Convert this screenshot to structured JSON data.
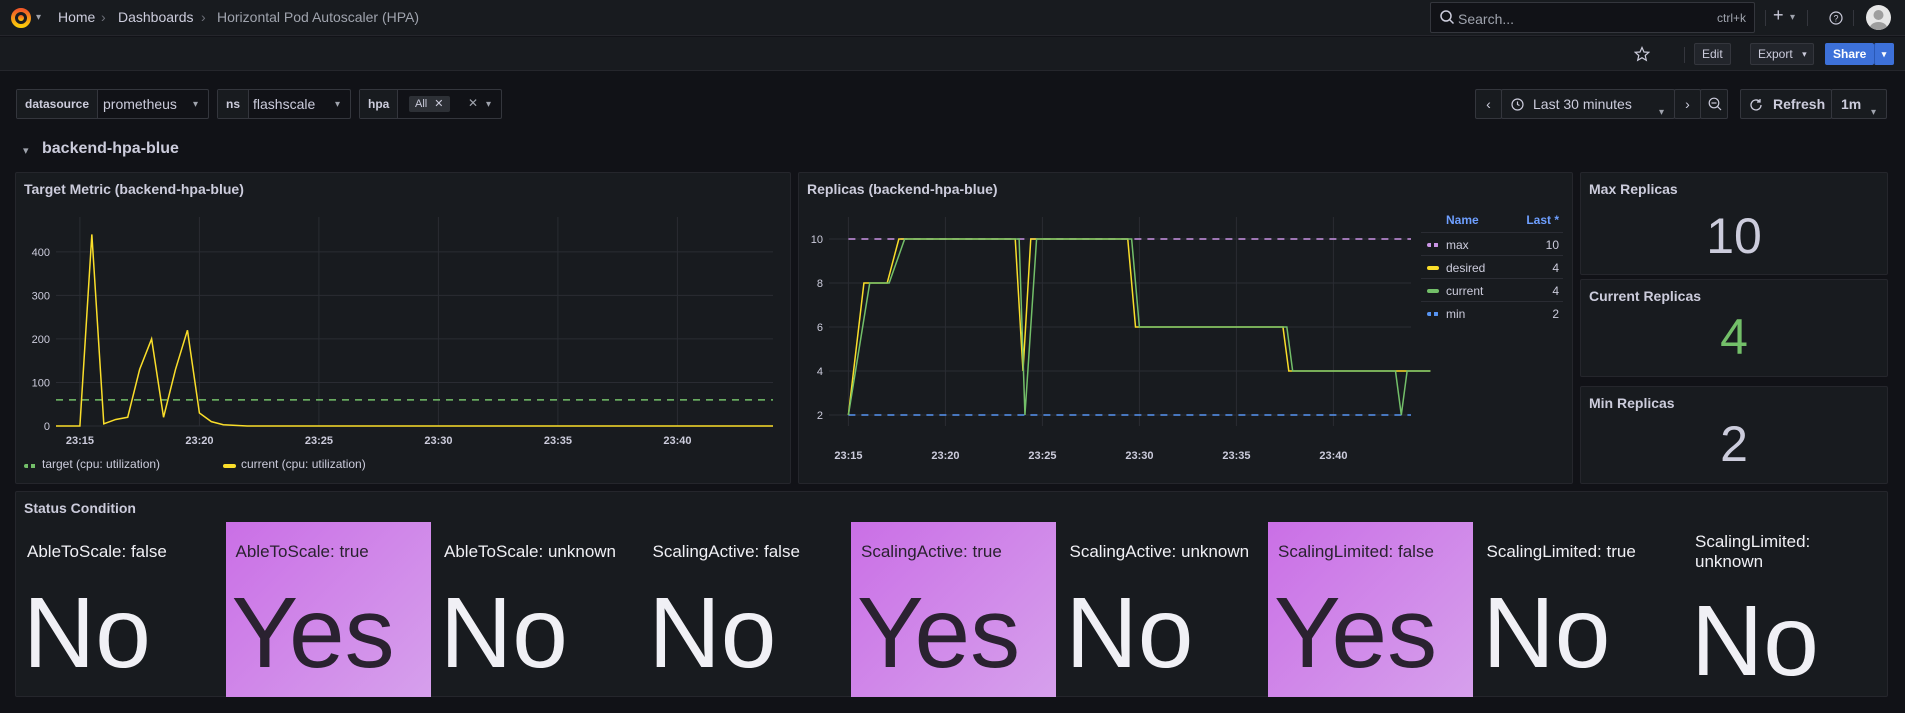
{
  "breadcrumb": {
    "home": "Home",
    "dashboards": "Dashboards",
    "current": "Horizontal Pod Autoscaler (HPA)"
  },
  "search": {
    "placeholder": "Search...",
    "shortcut": "ctrl+k"
  },
  "toolbar": {
    "edit": "Edit",
    "export": "Export",
    "share": "Share"
  },
  "variables": [
    {
      "label": "datasource",
      "value": "prometheus"
    },
    {
      "label": "ns",
      "value": "flashscale"
    },
    {
      "label": "hpa",
      "value": "All"
    }
  ],
  "time": {
    "range": "Last 30 minutes",
    "refresh": "Refresh",
    "interval": "1m"
  },
  "row": {
    "title": "backend-hpa-blue"
  },
  "colors": {
    "accent": "#3d71d9",
    "green": "#73bf69",
    "yellow": "#fade2a",
    "purple": "#ca95e5",
    "blue": "#5794f2",
    "cell": "#ca7ae8"
  },
  "chart_data": [
    {
      "type": "line",
      "title": "Target Metric (backend-hpa-blue)",
      "x_ticks": [
        "23:15",
        "23:20",
        "23:25",
        "23:30",
        "23:35",
        "23:40"
      ],
      "y_ticks": [
        "0",
        "100",
        "200",
        "300",
        "400"
      ],
      "ylim": [
        0,
        480
      ],
      "series": [
        {
          "name": "target (cpu: utilization)",
          "color": "#73bf69",
          "dashed": true,
          "x": [
            "23:14",
            "23:44"
          ],
          "values": [
            60,
            60
          ]
        },
        {
          "name": "current (cpu: utilization)",
          "color": "#fade2a",
          "x": [
            "23:14",
            "23:15",
            "23:15:30",
            "23:16",
            "23:16:30",
            "23:17",
            "23:17:30",
            "23:18",
            "23:18:30",
            "23:19",
            "23:19:30",
            "23:20",
            "23:20:30",
            "23:21",
            "23:22",
            "23:44"
          ],
          "values": [
            0,
            0,
            440,
            5,
            15,
            20,
            130,
            200,
            20,
            130,
            220,
            30,
            10,
            3,
            0,
            0
          ]
        }
      ]
    },
    {
      "type": "line",
      "title": "Replicas (backend-hpa-blue)",
      "x_ticks": [
        "23:15",
        "23:20",
        "23:25",
        "23:30",
        "23:35",
        "23:40"
      ],
      "y_ticks": [
        "2",
        "4",
        "6",
        "8",
        "10"
      ],
      "ylim": [
        1.5,
        11
      ],
      "legend_header": {
        "name": "Name",
        "last": "Last *"
      },
      "series": [
        {
          "name": "max",
          "last": "10",
          "color": "#ca95e5",
          "dashed": true
        },
        {
          "name": "desired",
          "last": "4",
          "color": "#fade2a"
        },
        {
          "name": "current",
          "last": "4",
          "color": "#73bf69"
        },
        {
          "name": "min",
          "last": "2",
          "color": "#5794f2",
          "dashed": true
        }
      ]
    }
  ],
  "stats": [
    {
      "title": "Max Replicas",
      "value": "10",
      "color": "#ccccdc"
    },
    {
      "title": "Current Replicas",
      "value": "4",
      "color": "#73bf69"
    },
    {
      "title": "Min Replicas",
      "value": "2",
      "color": "#ccccdc"
    }
  ],
  "status": {
    "title": "Status Condition",
    "cells": [
      {
        "label": "AbleToScale: false",
        "value": "No",
        "highlight": false
      },
      {
        "label": "AbleToScale: true",
        "value": "Yes",
        "highlight": true
      },
      {
        "label": "AbleToScale: unknown",
        "value": "No",
        "highlight": false
      },
      {
        "label": "ScalingActive: false",
        "value": "No",
        "highlight": false
      },
      {
        "label": "ScalingActive: true",
        "value": "Yes",
        "highlight": true
      },
      {
        "label": "ScalingActive: unknown",
        "value": "No",
        "highlight": false
      },
      {
        "label": "ScalingLimited: false",
        "value": "Yes",
        "highlight": true
      },
      {
        "label": "ScalingLimited: true",
        "value": "No",
        "highlight": false
      },
      {
        "label": "ScalingLimited: unknown",
        "value": "No",
        "highlight": false
      }
    ]
  }
}
